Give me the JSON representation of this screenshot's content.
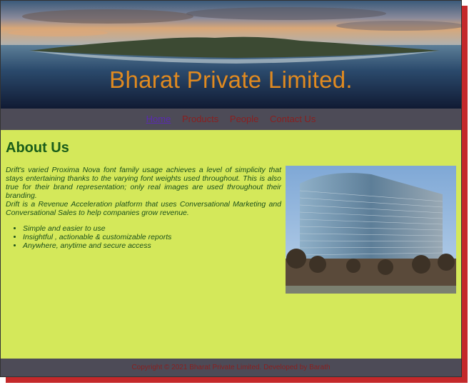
{
  "banner": {
    "title": "Bharat Private Limited."
  },
  "nav": {
    "items": [
      {
        "label": "Home"
      },
      {
        "label": "Products"
      },
      {
        "label": "People"
      },
      {
        "label": "Contact Us"
      }
    ]
  },
  "about": {
    "heading": "About Us",
    "paragraph1": "Drift's varied Proxima Nova font family usage achieves a level of simplicity that stays entertaining thanks to the varying font weights used throughout. This is also true for their brand representation; only real images are used throughout their branding.",
    "paragraph2": "Drift is a Revenue Acceleration platform that uses Conversational Marketing and Conversational Sales to help companies grow revenue.",
    "bullets": [
      "Simple and easier to use",
      "Insightful , actionable & customizable reports",
      "Anywhere, anytime and secure access"
    ]
  },
  "footer": {
    "text": "Copyright © 2021 Bharat Private Limited. Developed by Barath"
  },
  "colors": {
    "background": "#d4e85a",
    "nav_bar": "#4d4b57",
    "title": "#e08a20",
    "heading": "#1a5d1a",
    "link": "#8a1f1f",
    "active_link": "#5a2ab0",
    "shadow": "#c4282a"
  }
}
